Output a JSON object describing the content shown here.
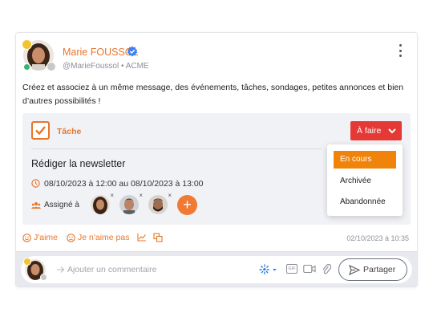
{
  "post": {
    "author_name": "Marie FOUSSOL",
    "author_handle": "@MarieFoussol",
    "separator": "•",
    "company": "ACME",
    "text": "Créez et associez à un même message, des événements, tâches, sondages, petites annonces et bien d’autres possibilités !",
    "time": "02/10/2023 à 10:35"
  },
  "task": {
    "type_label": "Tâche",
    "status_label": "À faire",
    "title": "Rédiger la newsletter",
    "dates": "08/10/2023 à 12:00 au 08/10/2023 à 13:00",
    "assigned_label": "Assigné à",
    "remove_glyph": "×",
    "add_glyph": "+"
  },
  "status_menu": {
    "options": [
      "En cours",
      "Archivée",
      "Abandonnée"
    ],
    "active": "En cours"
  },
  "reactions": {
    "like": "J'aime",
    "dislike": "Je n'aime pas"
  },
  "comment": {
    "placeholder": "Ajouter un commentaire",
    "gif_label": "GIF",
    "share_label": "Partager"
  },
  "colors": {
    "accent": "#e8762b",
    "status_red": "#e53935",
    "menu_active": "#f0830a",
    "verified_blue": "#3b82f6",
    "online_green": "#3cb371"
  },
  "icons": [
    "crown-badge-icon",
    "verified-icon",
    "more-vertical-icon",
    "task-check-icon",
    "chevron-down-icon",
    "clock-icon",
    "users-icon",
    "close-icon",
    "plus-icon",
    "smile-icon",
    "frown-icon",
    "chart-icon",
    "copy-icon",
    "send-icon",
    "sparkle-icon",
    "gif-icon",
    "video-icon",
    "paperclip-icon",
    "paper-plane-icon"
  ]
}
